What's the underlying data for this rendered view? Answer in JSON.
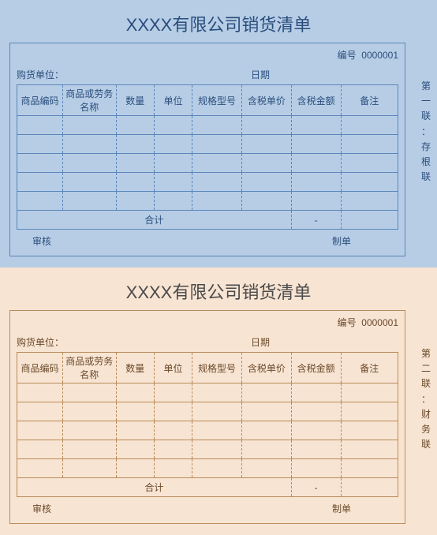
{
  "copies": [
    {
      "title": "XXXX有限公司销货清单",
      "number_label": "编号",
      "number_value": "0000001",
      "buyer_label": "购货单位：",
      "date_label": "日期",
      "headers": [
        "商品编码",
        "商品或劳务名称",
        "数量",
        "单位",
        "规格型号",
        "含税单价",
        "含税金额",
        "备注"
      ],
      "rows": [
        [
          "",
          "",
          "",
          "",
          "",
          "",
          "",
          ""
        ],
        [
          "",
          "",
          "",
          "",
          "",
          "",
          "",
          ""
        ],
        [
          "",
          "",
          "",
          "",
          "",
          "",
          "",
          ""
        ],
        [
          "",
          "",
          "",
          "",
          "",
          "",
          "",
          ""
        ],
        [
          "",
          "",
          "",
          "",
          "",
          "",
          "",
          ""
        ]
      ],
      "total_label": "合计",
      "total_dash": "-",
      "auditor_label": "审核",
      "preparer_label": "制单",
      "side_label": "第一联：存根联"
    },
    {
      "title": "XXXX有限公司销货清单",
      "number_label": "编号",
      "number_value": "0000001",
      "buyer_label": "购货单位：",
      "date_label": "日期",
      "headers": [
        "商品编码",
        "商品或劳务名称",
        "数量",
        "单位",
        "规格型号",
        "含税单价",
        "含税金额",
        "备注"
      ],
      "rows": [
        [
          "",
          "",
          "",
          "",
          "",
          "",
          "",
          ""
        ],
        [
          "",
          "",
          "",
          "",
          "",
          "",
          "",
          ""
        ],
        [
          "",
          "",
          "",
          "",
          "",
          "",
          "",
          ""
        ],
        [
          "",
          "",
          "",
          "",
          "",
          "",
          "",
          ""
        ],
        [
          "",
          "",
          "",
          "",
          "",
          "",
          "",
          ""
        ]
      ],
      "total_label": "合计",
      "total_dash": "-",
      "auditor_label": "审核",
      "preparer_label": "制单",
      "side_label": "第二联：财务联"
    }
  ]
}
